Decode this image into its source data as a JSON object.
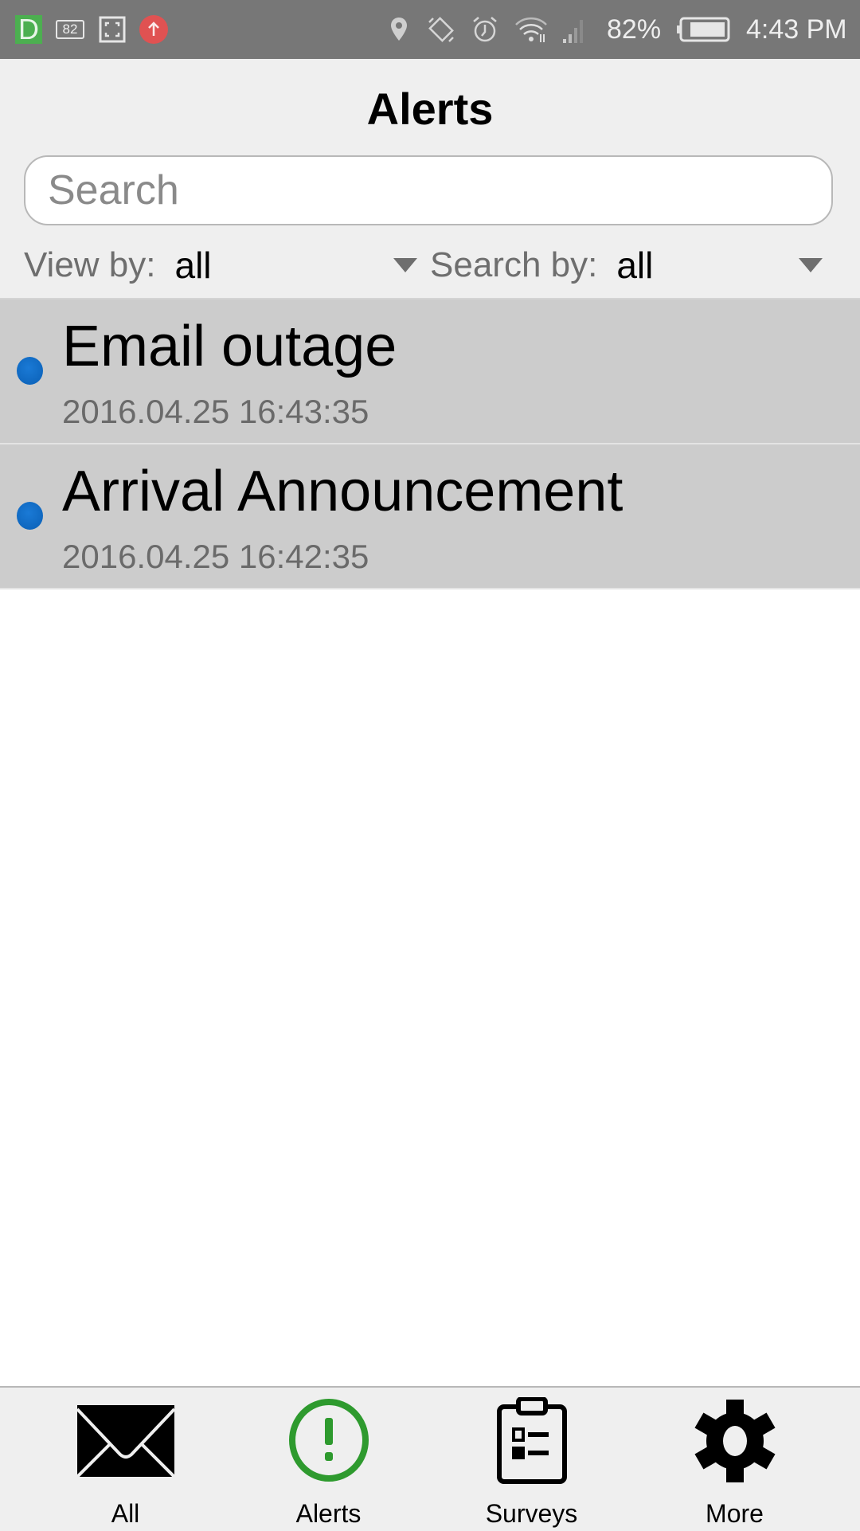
{
  "status_bar": {
    "left_icons": [
      "d-app-icon",
      "battery-82-icon",
      "screenshot-icon",
      "upload-icon"
    ],
    "battery_badge": "82",
    "notification_letter": "D",
    "right_icons": [
      "location-icon",
      "rotation-icon",
      "alarm-icon",
      "wifi-icon",
      "signal-icon",
      "battery-icon"
    ],
    "battery_percent": "82%",
    "time": "4:43 PM"
  },
  "header": {
    "title": "Alerts",
    "search": {
      "placeholder": "Search",
      "value": ""
    },
    "view_by": {
      "label": "View by:",
      "value": "all"
    },
    "search_by": {
      "label": "Search by:",
      "value": "all"
    }
  },
  "alerts": [
    {
      "title": "Email outage",
      "timestamp": "2016.04.25 16:43:35",
      "unread": true
    },
    {
      "title": "Arrival Announcement",
      "timestamp": "2016.04.25 16:42:35",
      "unread": true
    }
  ],
  "bottom_nav": {
    "active": "Alerts",
    "active_color": "#2e9a2e",
    "items": [
      {
        "label": "All",
        "icon": "envelope-icon"
      },
      {
        "label": "Alerts",
        "icon": "exclamation-circle-icon"
      },
      {
        "label": "Surveys",
        "icon": "clipboard-icon"
      },
      {
        "label": "More",
        "icon": "gear-icon"
      }
    ]
  }
}
